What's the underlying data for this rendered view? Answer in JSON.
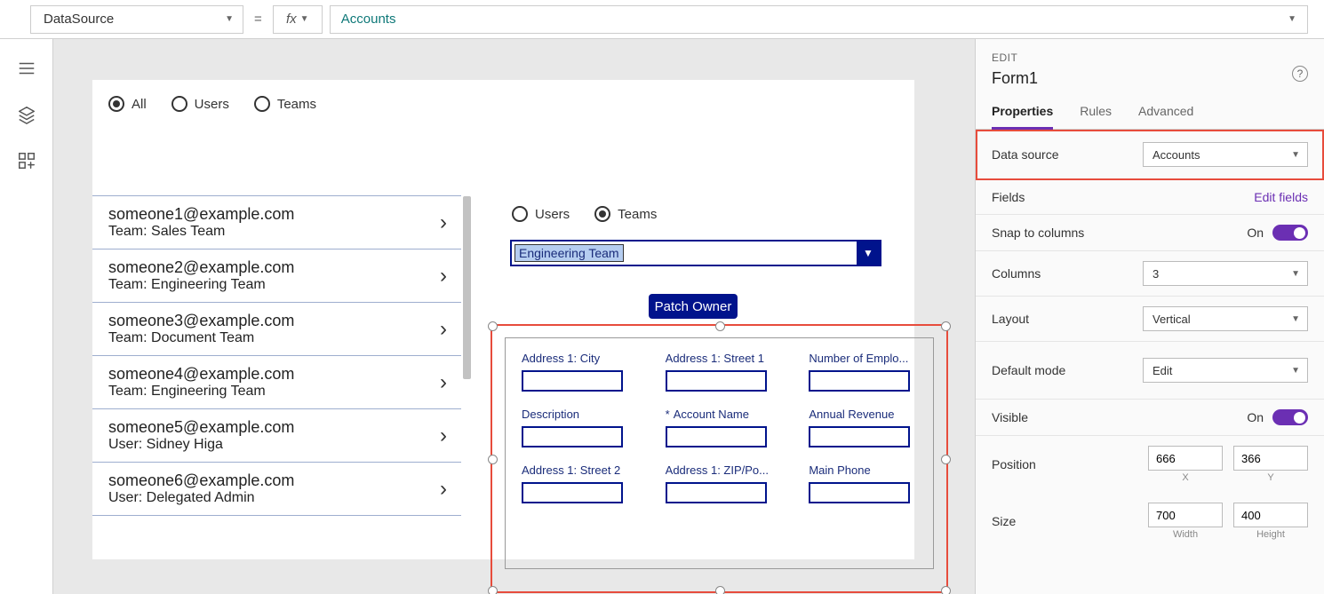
{
  "formula_bar": {
    "property": "DataSource",
    "equals": "=",
    "fx": "fx",
    "value": "Accounts"
  },
  "canvas": {
    "top_filter": [
      {
        "label": "All",
        "selected": true
      },
      {
        "label": "Users",
        "selected": false
      },
      {
        "label": "Teams",
        "selected": false
      }
    ],
    "list": [
      {
        "email": "someone1@example.com",
        "sub": "Team: Sales Team"
      },
      {
        "email": "someone2@example.com",
        "sub": "Team: Engineering Team"
      },
      {
        "email": "someone3@example.com",
        "sub": "Team: Document Team"
      },
      {
        "email": "someone4@example.com",
        "sub": "Team: Engineering Team"
      },
      {
        "email": "someone5@example.com",
        "sub": "User: Sidney Higa"
      },
      {
        "email": "someone6@example.com",
        "sub": "User: Delegated Admin"
      }
    ],
    "right_filter": [
      {
        "label": "Users",
        "selected": false
      },
      {
        "label": "Teams",
        "selected": true
      }
    ],
    "team_dropdown": "Engineering Team",
    "patch_button": "Patch Owner",
    "form_fields": [
      {
        "label": "Address 1: City",
        "req": false
      },
      {
        "label": "Address 1: Street 1",
        "req": false
      },
      {
        "label": "Number of Emplo...",
        "req": false
      },
      {
        "label": "Description",
        "req": false
      },
      {
        "label": "Account Name",
        "req": true
      },
      {
        "label": "Annual Revenue",
        "req": false
      },
      {
        "label": "Address 1: Street 2",
        "req": false
      },
      {
        "label": "Address 1: ZIP/Po...",
        "req": false
      },
      {
        "label": "Main Phone",
        "req": false
      }
    ]
  },
  "panel": {
    "edit": "EDIT",
    "name": "Form1",
    "tabs": {
      "properties": "Properties",
      "rules": "Rules",
      "advanced": "Advanced"
    },
    "rows": {
      "data_source": {
        "label": "Data source",
        "value": "Accounts"
      },
      "fields": {
        "label": "Fields",
        "link": "Edit fields"
      },
      "snap": {
        "label": "Snap to columns",
        "value": "On"
      },
      "columns": {
        "label": "Columns",
        "value": "3"
      },
      "layout": {
        "label": "Layout",
        "value": "Vertical"
      },
      "default_mode": {
        "label": "Default mode",
        "value": "Edit"
      },
      "visible": {
        "label": "Visible",
        "value": "On"
      },
      "position": {
        "label": "Position",
        "x": "666",
        "y": "366",
        "xl": "X",
        "yl": "Y"
      },
      "size": {
        "label": "Size",
        "w": "700",
        "h": "400",
        "wl": "Width",
        "hl": "Height"
      }
    }
  }
}
